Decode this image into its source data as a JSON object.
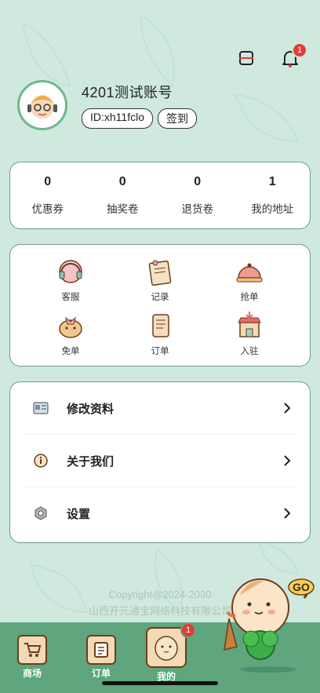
{
  "header": {
    "notification_count": "1"
  },
  "profile": {
    "name": "4201测试账号",
    "id_label": "ID:xh11fclo",
    "checkin_label": "签到"
  },
  "stats": [
    {
      "value": "0",
      "label": "优惠券"
    },
    {
      "value": "0",
      "label": "抽奖卷"
    },
    {
      "value": "0",
      "label": "退货卷"
    },
    {
      "value": "1",
      "label": "我的地址"
    }
  ],
  "services": [
    {
      "label": "客服",
      "icon": "headset-icon"
    },
    {
      "label": "记录",
      "icon": "record-icon"
    },
    {
      "label": "抢单",
      "icon": "bell-dish-icon"
    },
    {
      "label": "免单",
      "icon": "hamster-bow-icon"
    },
    {
      "label": "订单",
      "icon": "scroll-icon"
    },
    {
      "label": "入驻",
      "icon": "store-icon"
    }
  ],
  "menu": [
    {
      "label": "修改资料",
      "icon": "id-card-icon"
    },
    {
      "label": "关于我们",
      "icon": "info-icon"
    },
    {
      "label": "设置",
      "icon": "settings-icon"
    }
  ],
  "footer": {
    "copyright": "Copyright@2024-2030",
    "company": "山西开元通宝网络科技有限公司"
  },
  "tabs": [
    {
      "label": "商场",
      "icon": "cart-icon"
    },
    {
      "label": "订单",
      "icon": "order-icon"
    },
    {
      "label": "我的",
      "icon": "mine-icon",
      "badge": "1"
    }
  ],
  "mascot": {
    "text": "GO"
  },
  "colors": {
    "accent": "#5fa57e",
    "background": "#cfe9df",
    "badge": "#e23b3b"
  }
}
